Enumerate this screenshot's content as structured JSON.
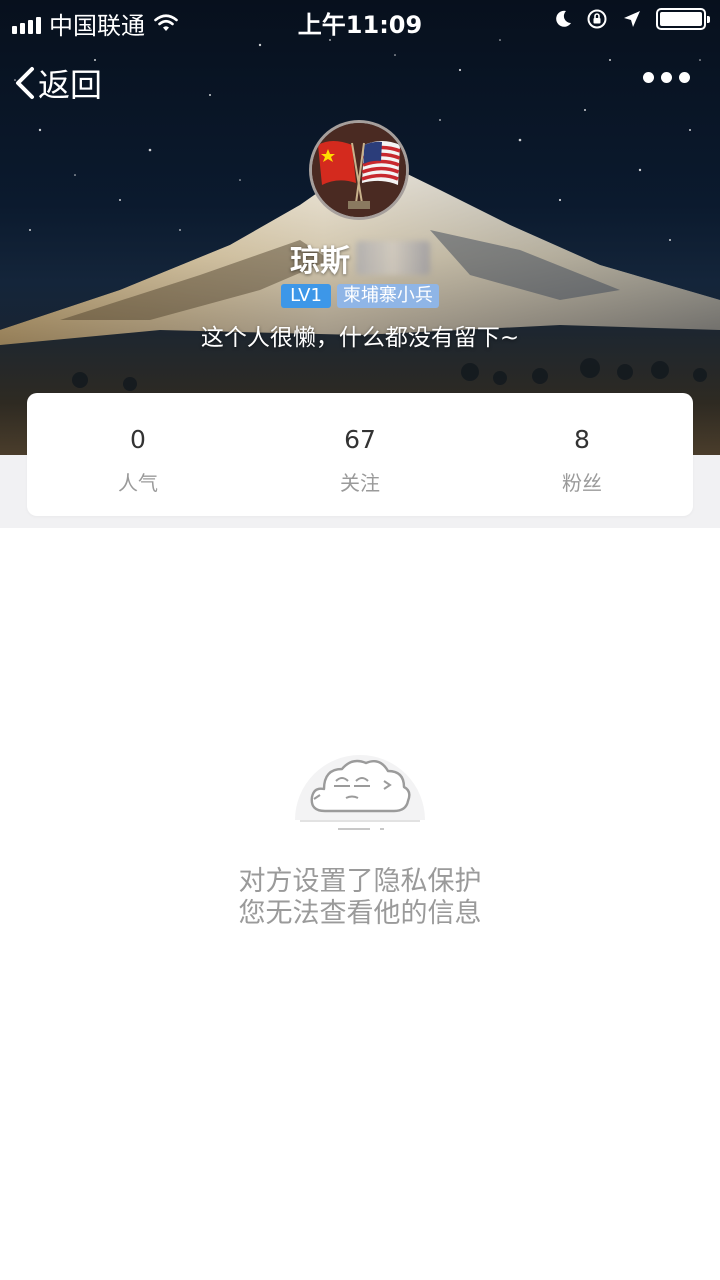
{
  "status_bar": {
    "carrier": "中国联通",
    "time": "上午11:09"
  },
  "nav": {
    "back_label": "返回"
  },
  "profile": {
    "username": "琼斯",
    "level_badge": "LV1",
    "title_badge": "柬埔寨小兵",
    "bio": "这个人很懒，什么都没有留下~"
  },
  "stats": [
    {
      "value": "0",
      "label": "人气"
    },
    {
      "value": "67",
      "label": "关注"
    },
    {
      "value": "8",
      "label": "粉丝"
    }
  ],
  "privacy": {
    "line1": "对方设置了隐私保护",
    "line2": "您无法查看他的信息"
  },
  "colors": {
    "accent_blue": "#3d97e8",
    "title_badge_blue": "#8fb5e6",
    "muted_text": "#9a9a9a",
    "band_gray": "#f1f1f3"
  }
}
